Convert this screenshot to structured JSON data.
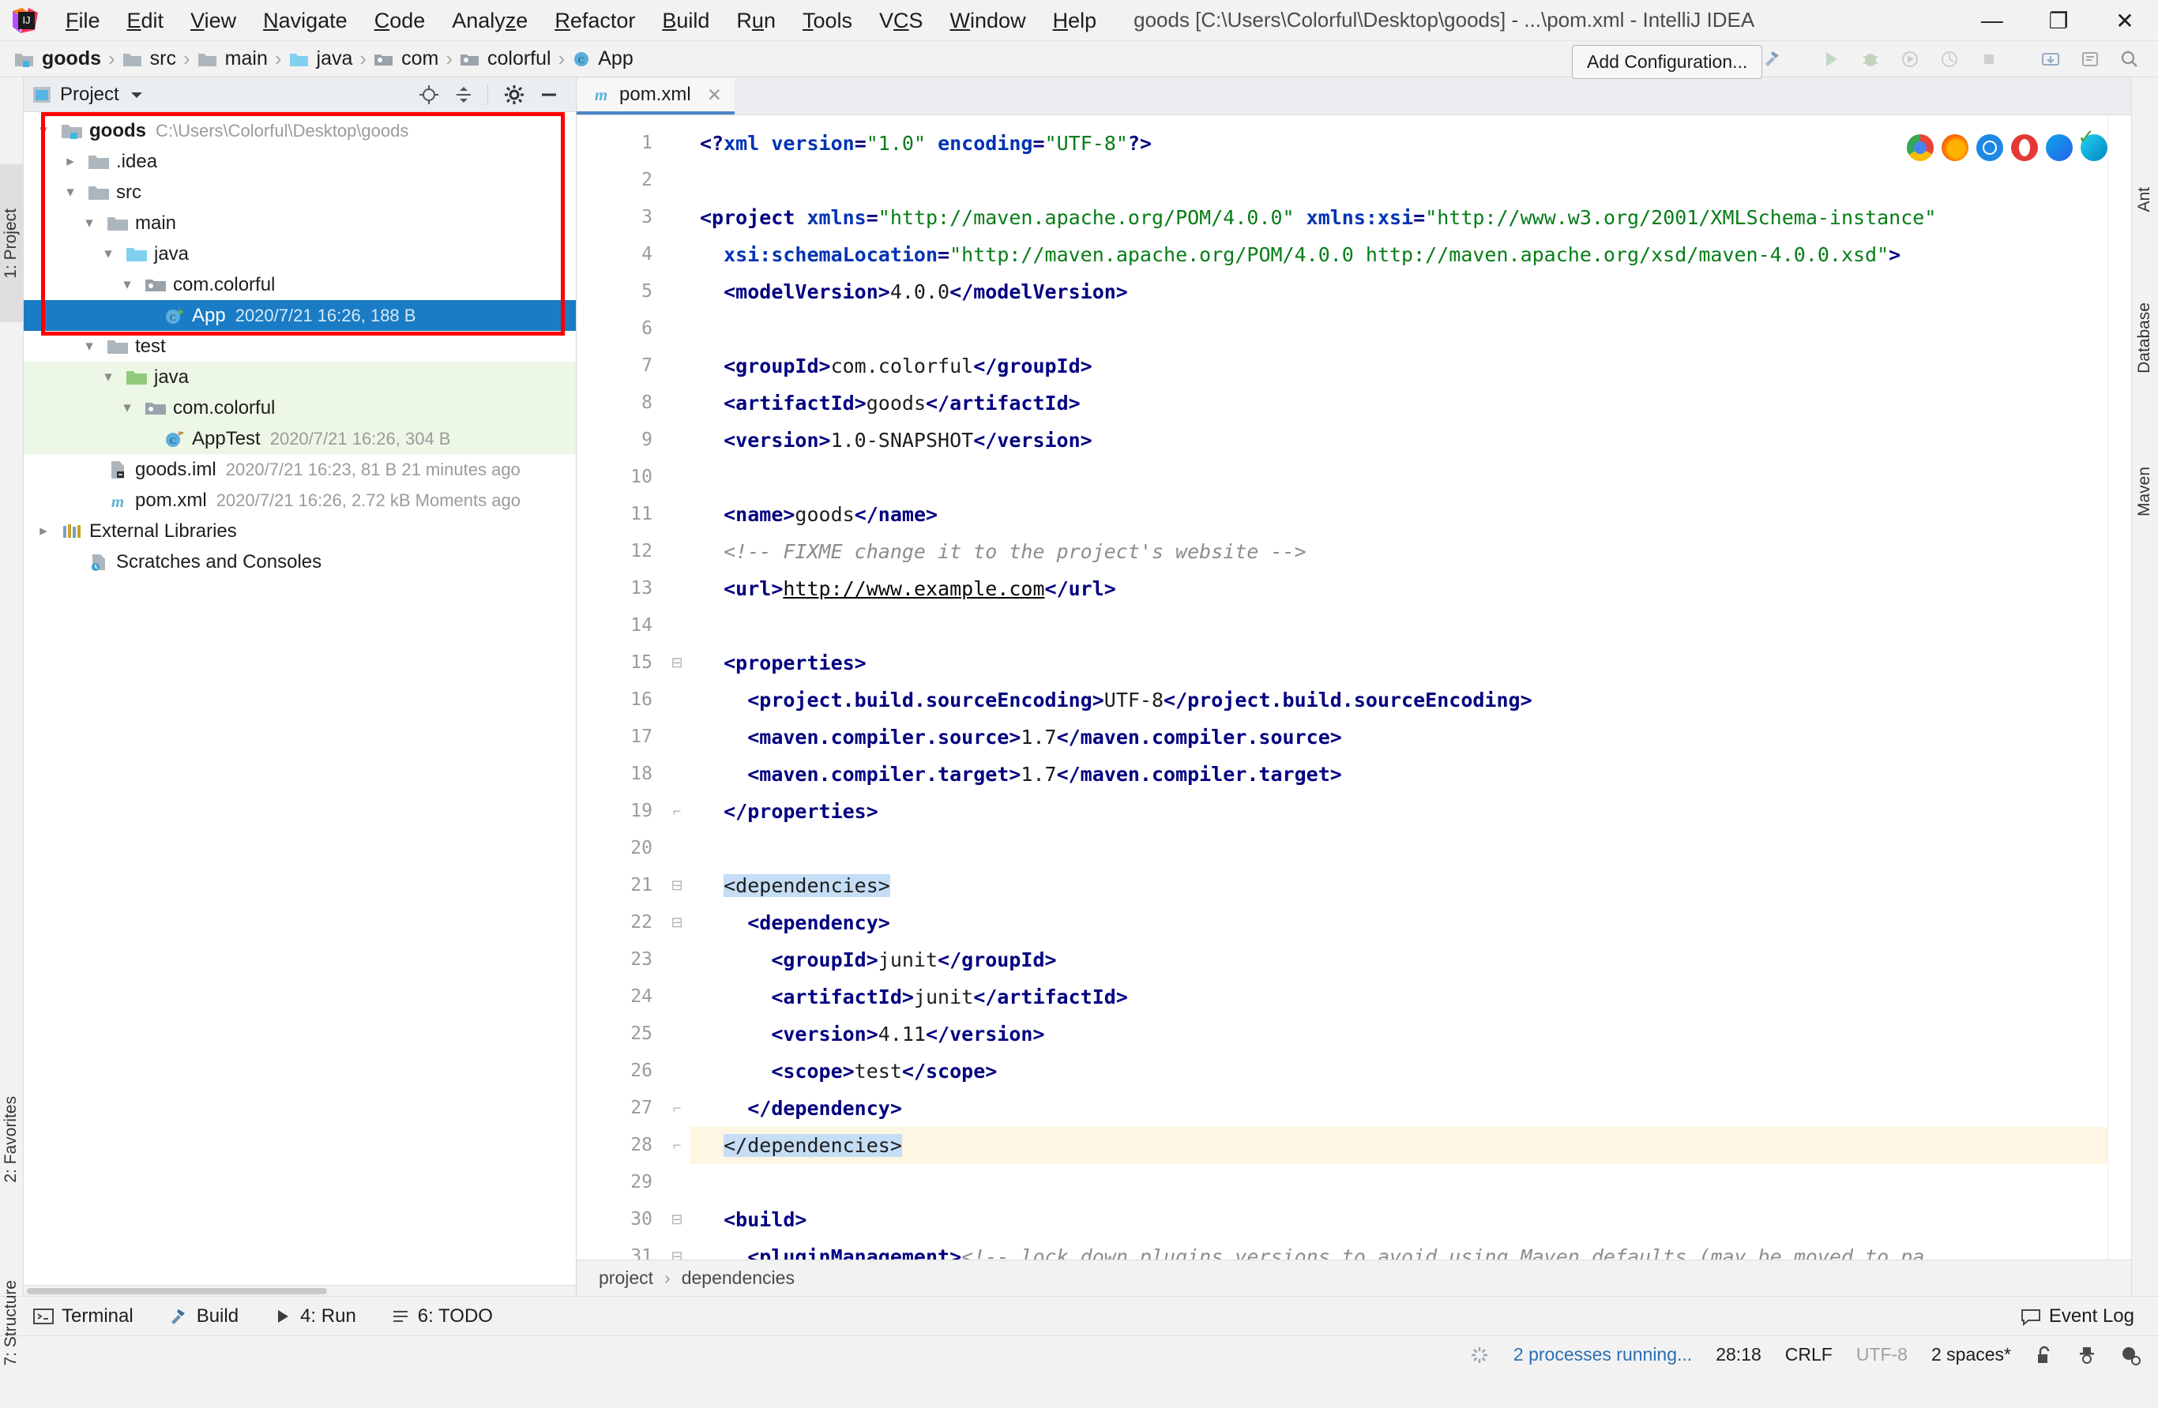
{
  "window": {
    "title": "goods [C:\\Users\\Colorful\\Desktop\\goods] - ...\\pom.xml - IntelliJ IDEA",
    "minimize": "—",
    "maximize": "❐",
    "close": "✕",
    "logo_icon": "intellij-idea-logo"
  },
  "menubar": {
    "items": [
      {
        "label": "File",
        "mnemonic": "F"
      },
      {
        "label": "Edit",
        "mnemonic": "E"
      },
      {
        "label": "View",
        "mnemonic": "V"
      },
      {
        "label": "Navigate",
        "mnemonic": "N"
      },
      {
        "label": "Code",
        "mnemonic": "C"
      },
      {
        "label": "Analyze",
        "mnemonic": "z"
      },
      {
        "label": "Refactor",
        "mnemonic": "R"
      },
      {
        "label": "Build",
        "mnemonic": "B"
      },
      {
        "label": "Run",
        "mnemonic": "u"
      },
      {
        "label": "Tools",
        "mnemonic": "T"
      },
      {
        "label": "VCS",
        "mnemonic": "S"
      },
      {
        "label": "Window",
        "mnemonic": "W"
      },
      {
        "label": "Help",
        "mnemonic": "H"
      }
    ]
  },
  "navbar": {
    "crumbs": [
      {
        "label": "goods",
        "icon": "module-folder-icon",
        "bold": true
      },
      {
        "label": "src",
        "icon": "folder-icon",
        "bold": false
      },
      {
        "label": "main",
        "icon": "folder-icon",
        "bold": false
      },
      {
        "label": "java",
        "icon": "source-root-folder-icon",
        "bold": false
      },
      {
        "label": "com",
        "icon": "package-icon",
        "bold": false
      },
      {
        "label": "colorful",
        "icon": "package-icon",
        "bold": false
      },
      {
        "label": "App",
        "icon": "java-class-icon",
        "bold": false
      }
    ],
    "separator": "›",
    "add_configuration": "Add Configuration...",
    "icons": [
      "hammer-icon",
      "run-icon",
      "debug-icon",
      "run-coverage-icon",
      "profiler-icon",
      "stop-icon",
      "git-icon",
      "updates-icon",
      "search-icon"
    ]
  },
  "left_rail": {
    "tabs": [
      {
        "label": "1: Project",
        "selected": true
      },
      {
        "label": "2: Favorites",
        "selected": false
      },
      {
        "label": "7: Structure",
        "selected": false
      }
    ]
  },
  "right_rail": {
    "tabs": [
      {
        "label": "Ant"
      },
      {
        "label": "Database"
      },
      {
        "label": "Maven"
      }
    ]
  },
  "project_panel": {
    "title": "Project",
    "dropdown_icon": "chevron-down-icon",
    "tool_icons": [
      "locate-icon",
      "collapse-all-icon",
      "settings-gear-icon",
      "hide-icon"
    ],
    "tree": [
      {
        "depth": 0,
        "arrow": "expanded",
        "icon": "module-folder-icon",
        "label": "goods",
        "bold": true,
        "meta": "C:\\Users\\Colorful\\Desktop\\goods",
        "state": "normal"
      },
      {
        "depth": 1,
        "arrow": "collapsed",
        "icon": "folder-icon",
        "label": ".idea",
        "bold": false,
        "meta": "",
        "state": "normal"
      },
      {
        "depth": 1,
        "arrow": "expanded",
        "icon": "folder-icon",
        "label": "src",
        "bold": false,
        "meta": "",
        "state": "normal"
      },
      {
        "depth": 2,
        "arrow": "expanded",
        "icon": "folder-icon",
        "label": "main",
        "bold": false,
        "meta": "",
        "state": "normal"
      },
      {
        "depth": 3,
        "arrow": "expanded",
        "icon": "source-root-folder-icon",
        "label": "java",
        "bold": false,
        "meta": "",
        "state": "normal"
      },
      {
        "depth": 4,
        "arrow": "expanded",
        "icon": "package-icon",
        "label": "com.colorful",
        "bold": false,
        "meta": "",
        "state": "normal"
      },
      {
        "depth": 5,
        "arrow": "none",
        "icon": "java-class-runnable-icon",
        "label": "App",
        "bold": false,
        "meta": "2020/7/21 16:26, 188 B",
        "state": "selected"
      },
      {
        "depth": 2,
        "arrow": "expanded",
        "icon": "folder-icon",
        "label": "test",
        "bold": false,
        "meta": "",
        "state": "normal"
      },
      {
        "depth": 3,
        "arrow": "expanded",
        "icon": "test-root-folder-icon",
        "label": "java",
        "bold": false,
        "meta": "",
        "state": "test"
      },
      {
        "depth": 4,
        "arrow": "expanded",
        "icon": "package-icon",
        "label": "com.colorful",
        "bold": false,
        "meta": "",
        "state": "test"
      },
      {
        "depth": 5,
        "arrow": "none",
        "icon": "java-test-class-icon",
        "label": "AppTest",
        "bold": false,
        "meta": "2020/7/21 16:26, 304 B",
        "state": "test"
      },
      {
        "depth": 1,
        "arrow": "none",
        "icon": "iml-file-icon",
        "label": "goods.iml",
        "bold": false,
        "meta": "2020/7/21 16:23, 81 B 21 minutes ago",
        "state": "normal"
      },
      {
        "depth": 1,
        "arrow": "none",
        "icon": "maven-pom-icon",
        "label": "pom.xml",
        "bold": false,
        "meta": "2020/7/21 16:26, 2.72 kB Moments ago",
        "state": "normal"
      },
      {
        "depth": 0,
        "arrow": "collapsed",
        "icon": "external-libraries-icon",
        "label": "External Libraries",
        "bold": false,
        "meta": "",
        "state": "normal"
      },
      {
        "depth": 0,
        "arrow": "none",
        "icon": "scratches-icon",
        "label": "Scratches and Consoles",
        "bold": false,
        "meta": "",
        "state": "normal"
      }
    ]
  },
  "editor": {
    "tab": {
      "label": "pom.xml",
      "icon": "maven-pom-icon",
      "close_icon": "close-icon"
    },
    "browser_icons": [
      "chrome-icon",
      "firefox-icon",
      "safari-icon",
      "opera-icon",
      "edge-icon",
      "edge-chromium-icon"
    ],
    "inspection_ok_icon": "checkmark-icon",
    "first_line": 1,
    "lines": [
      {
        "n": 1,
        "fold": "",
        "hl": false,
        "tokens": [
          {
            "t": "tag",
            "v": "<?"
          },
          {
            "t": "attr",
            "v": "xml"
          },
          {
            "t": "txt",
            "v": " "
          },
          {
            "t": "attr",
            "v": "version"
          },
          {
            "t": "tag",
            "v": "="
          },
          {
            "t": "str",
            "v": "\"1.0\""
          },
          {
            "t": "txt",
            "v": " "
          },
          {
            "t": "attr",
            "v": "encoding"
          },
          {
            "t": "tag",
            "v": "="
          },
          {
            "t": "str",
            "v": "\"UTF-8\""
          },
          {
            "t": "tag",
            "v": "?>"
          }
        ]
      },
      {
        "n": 2,
        "fold": "",
        "hl": false,
        "tokens": []
      },
      {
        "n": 3,
        "fold": "",
        "hl": false,
        "tokens": [
          {
            "t": "tag",
            "v": "<project "
          },
          {
            "t": "attr",
            "v": "xmlns"
          },
          {
            "t": "tag",
            "v": "="
          },
          {
            "t": "str",
            "v": "\"http://maven.apache.org/POM/4.0.0\""
          },
          {
            "t": "txt",
            "v": " "
          },
          {
            "t": "attr",
            "v": "xmlns:xsi"
          },
          {
            "t": "tag",
            "v": "="
          },
          {
            "t": "str",
            "v": "\"http://www.w3.org/2001/XMLSchema-instance\""
          }
        ]
      },
      {
        "n": 4,
        "fold": "",
        "hl": false,
        "tokens": [
          {
            "t": "txt",
            "v": "  "
          },
          {
            "t": "attr",
            "v": "xsi:schemaLocation"
          },
          {
            "t": "tag",
            "v": "="
          },
          {
            "t": "str",
            "v": "\"http://maven.apache.org/POM/4.0.0 http://maven.apache.org/xsd/maven-4.0.0.xsd\""
          },
          {
            "t": "tag",
            "v": ">"
          }
        ]
      },
      {
        "n": 5,
        "fold": "",
        "hl": false,
        "tokens": [
          {
            "t": "txt",
            "v": "  "
          },
          {
            "t": "tag",
            "v": "<modelVersion>"
          },
          {
            "t": "txt",
            "v": "4.0.0"
          },
          {
            "t": "tag",
            "v": "</modelVersion>"
          }
        ]
      },
      {
        "n": 6,
        "fold": "",
        "hl": false,
        "tokens": []
      },
      {
        "n": 7,
        "fold": "",
        "hl": false,
        "tokens": [
          {
            "t": "txt",
            "v": "  "
          },
          {
            "t": "tag",
            "v": "<groupId>"
          },
          {
            "t": "txt",
            "v": "com.colorful"
          },
          {
            "t": "tag",
            "v": "</groupId>"
          }
        ]
      },
      {
        "n": 8,
        "fold": "",
        "hl": false,
        "tokens": [
          {
            "t": "txt",
            "v": "  "
          },
          {
            "t": "tag",
            "v": "<artifactId>"
          },
          {
            "t": "txt",
            "v": "goods"
          },
          {
            "t": "tag",
            "v": "</artifactId>"
          }
        ]
      },
      {
        "n": 9,
        "fold": "",
        "hl": false,
        "tokens": [
          {
            "t": "txt",
            "v": "  "
          },
          {
            "t": "tag",
            "v": "<version>"
          },
          {
            "t": "txt",
            "v": "1.0-SNAPSHOT"
          },
          {
            "t": "tag",
            "v": "</version>"
          }
        ]
      },
      {
        "n": 10,
        "fold": "",
        "hl": false,
        "tokens": []
      },
      {
        "n": 11,
        "fold": "",
        "hl": false,
        "tokens": [
          {
            "t": "txt",
            "v": "  "
          },
          {
            "t": "tag",
            "v": "<name>"
          },
          {
            "t": "txt",
            "v": "goods"
          },
          {
            "t": "tag",
            "v": "</name>"
          }
        ]
      },
      {
        "n": 12,
        "fold": "",
        "hl": false,
        "tokens": [
          {
            "t": "txt",
            "v": "  "
          },
          {
            "t": "cmt",
            "v": "<!-- FIXME change it to the project's website -->"
          }
        ]
      },
      {
        "n": 13,
        "fold": "",
        "hl": false,
        "tokens": [
          {
            "t": "txt",
            "v": "  "
          },
          {
            "t": "tag",
            "v": "<url>"
          },
          {
            "t": "url",
            "v": "http://www.example.com"
          },
          {
            "t": "tag",
            "v": "</url>"
          }
        ]
      },
      {
        "n": 14,
        "fold": "",
        "hl": false,
        "tokens": []
      },
      {
        "n": 15,
        "fold": "start",
        "hl": false,
        "tokens": [
          {
            "t": "txt",
            "v": "  "
          },
          {
            "t": "tag",
            "v": "<properties>"
          }
        ]
      },
      {
        "n": 16,
        "fold": "",
        "hl": false,
        "tokens": [
          {
            "t": "txt",
            "v": "    "
          },
          {
            "t": "tag",
            "v": "<project.build.sourceEncoding>"
          },
          {
            "t": "txt",
            "v": "UTF-8"
          },
          {
            "t": "tag",
            "v": "</project.build.sourceEncoding>"
          }
        ]
      },
      {
        "n": 17,
        "fold": "",
        "hl": false,
        "tokens": [
          {
            "t": "txt",
            "v": "    "
          },
          {
            "t": "tag",
            "v": "<maven.compiler.source>"
          },
          {
            "t": "txt",
            "v": "1.7"
          },
          {
            "t": "tag",
            "v": "</maven.compiler.source>"
          }
        ]
      },
      {
        "n": 18,
        "fold": "",
        "hl": false,
        "tokens": [
          {
            "t": "txt",
            "v": "    "
          },
          {
            "t": "tag",
            "v": "<maven.compiler.target>"
          },
          {
            "t": "txt",
            "v": "1.7"
          },
          {
            "t": "tag",
            "v": "</maven.compiler.target>"
          }
        ]
      },
      {
        "n": 19,
        "fold": "end",
        "hl": false,
        "tokens": [
          {
            "t": "txt",
            "v": "  "
          },
          {
            "t": "tag",
            "v": "</properties>"
          }
        ]
      },
      {
        "n": 20,
        "fold": "",
        "hl": false,
        "tokens": []
      },
      {
        "n": 21,
        "fold": "start",
        "hl": false,
        "tokens": [
          {
            "t": "txt",
            "v": "  "
          },
          {
            "t": "sel",
            "v": "<dependencies>"
          }
        ]
      },
      {
        "n": 22,
        "fold": "start",
        "hl": false,
        "tokens": [
          {
            "t": "txt",
            "v": "    "
          },
          {
            "t": "tag",
            "v": "<dependency>"
          }
        ]
      },
      {
        "n": 23,
        "fold": "",
        "hl": false,
        "tokens": [
          {
            "t": "txt",
            "v": "      "
          },
          {
            "t": "tag",
            "v": "<groupId>"
          },
          {
            "t": "txt",
            "v": "junit"
          },
          {
            "t": "tag",
            "v": "</groupId>"
          }
        ]
      },
      {
        "n": 24,
        "fold": "",
        "hl": false,
        "tokens": [
          {
            "t": "txt",
            "v": "      "
          },
          {
            "t": "tag",
            "v": "<artifactId>"
          },
          {
            "t": "txt",
            "v": "junit"
          },
          {
            "t": "tag",
            "v": "</artifactId>"
          }
        ]
      },
      {
        "n": 25,
        "fold": "",
        "hl": false,
        "tokens": [
          {
            "t": "txt",
            "v": "      "
          },
          {
            "t": "tag",
            "v": "<version>"
          },
          {
            "t": "txt",
            "v": "4.11"
          },
          {
            "t": "tag",
            "v": "</version>"
          }
        ]
      },
      {
        "n": 26,
        "fold": "",
        "hl": false,
        "tokens": [
          {
            "t": "txt",
            "v": "      "
          },
          {
            "t": "tag",
            "v": "<scope>"
          },
          {
            "t": "txt",
            "v": "test"
          },
          {
            "t": "tag",
            "v": "</scope>"
          }
        ]
      },
      {
        "n": 27,
        "fold": "end",
        "hl": false,
        "tokens": [
          {
            "t": "txt",
            "v": "    "
          },
          {
            "t": "tag",
            "v": "</dependency>"
          }
        ]
      },
      {
        "n": 28,
        "fold": "end",
        "hl": true,
        "tokens": [
          {
            "t": "txt",
            "v": "  "
          },
          {
            "t": "sel",
            "v": "</dependencies>"
          }
        ]
      },
      {
        "n": 29,
        "fold": "",
        "hl": false,
        "tokens": []
      },
      {
        "n": 30,
        "fold": "start",
        "hl": false,
        "tokens": [
          {
            "t": "txt",
            "v": "  "
          },
          {
            "t": "tag",
            "v": "<build>"
          }
        ]
      },
      {
        "n": 31,
        "fold": "start",
        "hl": false,
        "tokens": [
          {
            "t": "txt",
            "v": "    "
          },
          {
            "t": "tag",
            "v": "<pluginManagement>"
          },
          {
            "t": "cmt",
            "v": "<!-- lock down plugins versions to avoid using Maven defaults (may be moved to pa"
          }
        ]
      }
    ],
    "breadcrumb": {
      "items": [
        "project",
        "dependencies"
      ],
      "separator": "›"
    }
  },
  "tool_windows": {
    "items": [
      {
        "label": "Terminal",
        "icon": "terminal-icon"
      },
      {
        "label": "Build",
        "icon": "build-hammer-icon"
      },
      {
        "label": "4: Run",
        "icon": "run-icon"
      },
      {
        "label": "6: TODO",
        "icon": "todo-icon"
      }
    ],
    "event_log": {
      "label": "Event Log",
      "icon": "event-log-icon"
    }
  },
  "statusbar": {
    "processes": "2 processes running...",
    "processes_icon": "spinner-icon",
    "caret": "28:18",
    "line_sep": "CRLF",
    "encoding": "UTF-8",
    "indent": "2 spaces*",
    "icons": [
      "lock-open-icon",
      "inspector-hat-icon",
      "notifications-icon"
    ]
  },
  "colors": {
    "accent": "#1a7cc4",
    "selection": "#1a7cc4",
    "test_bg": "#edf7e6",
    "highlight_line": "#fdf6e3",
    "red_annotation": "#fe0000",
    "link": "#2b6fb5"
  }
}
